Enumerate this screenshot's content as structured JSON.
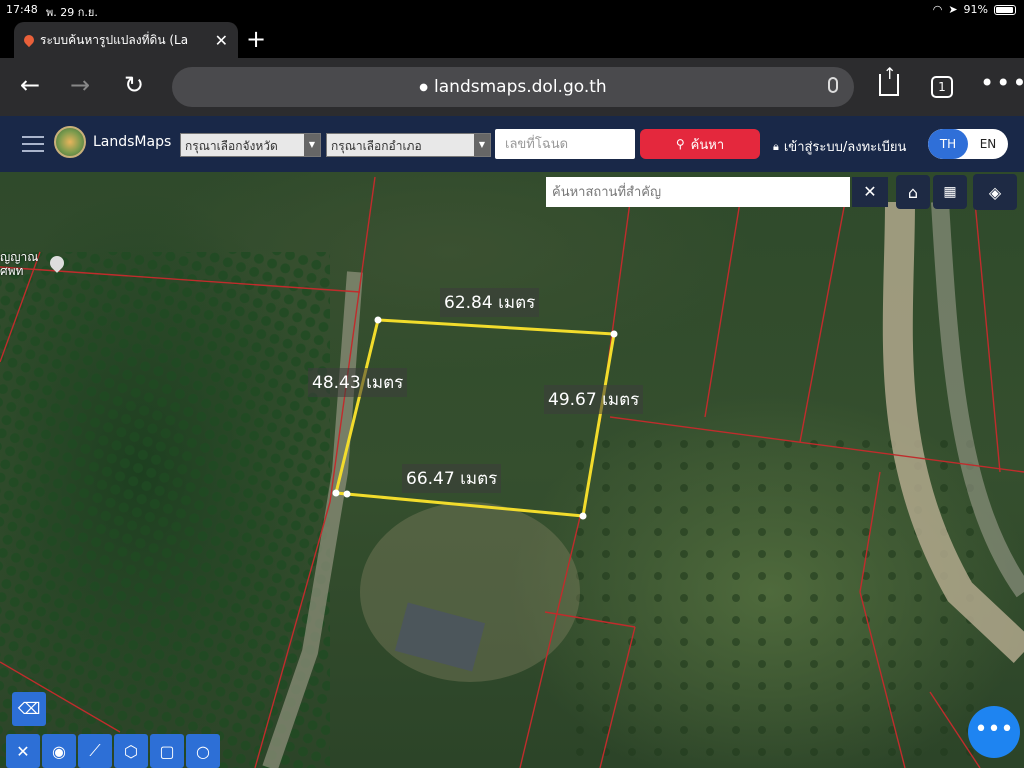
{
  "status_bar": {
    "time": "17:48",
    "date": "พ. 29 ก.ย.",
    "battery": "91%"
  },
  "browser": {
    "tab_title": "ระบบค้นหารูปแปลงที่ดิน (La",
    "url": "landsmaps.dol.go.th",
    "tab_count": "1"
  },
  "app": {
    "brand": "LandsMaps",
    "province_select": "กรุณาเลือกจังหวัด",
    "district_select": "กรุณาเลือกอำเภอ",
    "deed_placeholder": "เลขที่โฉนด",
    "search_label": "ค้นหา",
    "login_label": "เข้าสู่ระบบ/ลงทะเบียน",
    "lang_th": "TH",
    "lang_en": "EN"
  },
  "map": {
    "place_search_placeholder": "ค้นหาสถานที่สำคัญ",
    "poi_label_line1": "ญญาณ",
    "poi_label_line2": "ศพท",
    "measurements": {
      "top": "62.84 เมตร",
      "left": "48.43 เมตร",
      "right": "49.67 เมตร",
      "bottom": "66.47 เมตร"
    },
    "colors": {
      "parcel_outline": "#f2dc2c",
      "boundary_lines": "#c02c2c"
    }
  }
}
